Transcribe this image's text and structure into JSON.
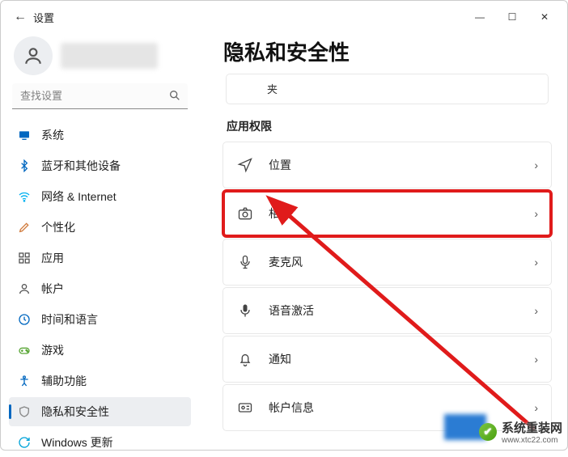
{
  "window": {
    "title": "设置",
    "back_icon": "←",
    "min": "—",
    "max": "☐",
    "close": "✕"
  },
  "search": {
    "placeholder": "查找设置"
  },
  "nav": [
    {
      "id": "system",
      "label": "系统",
      "color": "#0067c0"
    },
    {
      "id": "bluetooth",
      "label": "蓝牙和其他设备",
      "color": "#0067c0"
    },
    {
      "id": "network",
      "label": "网络 & Internet",
      "color": "#00b0f0"
    },
    {
      "id": "personalize",
      "label": "个性化",
      "color": "#d07a3c"
    },
    {
      "id": "apps",
      "label": "应用",
      "color": "#555"
    },
    {
      "id": "accounts",
      "label": "帐户",
      "color": "#555"
    },
    {
      "id": "time",
      "label": "时间和语言",
      "color": "#0067c0"
    },
    {
      "id": "gaming",
      "label": "游戏",
      "color": "#5aa637"
    },
    {
      "id": "accessibility",
      "label": "辅助功能",
      "color": "#0067c0"
    },
    {
      "id": "privacy",
      "label": "隐私和安全性",
      "color": "#888",
      "selected": true
    },
    {
      "id": "update",
      "label": "Windows 更新",
      "color": "#00a3d9"
    }
  ],
  "page": {
    "heading": "隐私和安全性",
    "stub_text": "夹",
    "section_label": "应用权限",
    "items": [
      {
        "id": "location",
        "label": "位置"
      },
      {
        "id": "camera",
        "label": "相机",
        "highlight": true
      },
      {
        "id": "microphone",
        "label": "麦克风"
      },
      {
        "id": "voice",
        "label": "语音激活"
      },
      {
        "id": "notifications",
        "label": "通知"
      },
      {
        "id": "account-info",
        "label": "帐户信息"
      }
    ]
  },
  "watermark": {
    "site": "系统重装网",
    "url": "www.xtc22.com"
  },
  "highlight_color": "#e01b1b"
}
